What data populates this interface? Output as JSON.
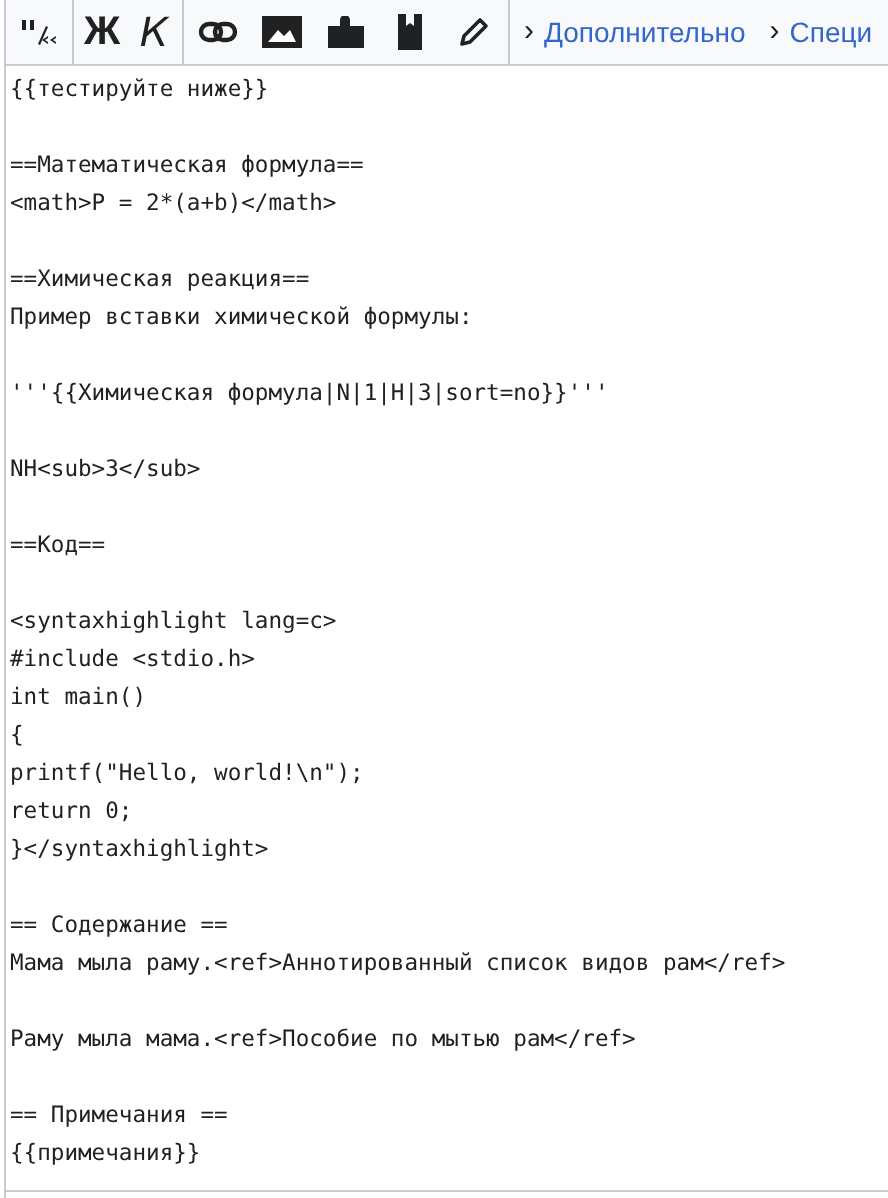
{
  "toolbar": {
    "buttons": [
      {
        "kind": "signature"
      },
      {
        "kind": "text",
        "label": "Ж",
        "italic": false
      },
      {
        "kind": "text",
        "label": "К",
        "italic": true
      },
      {
        "kind": "link"
      },
      {
        "kind": "image"
      },
      {
        "kind": "puzzle"
      },
      {
        "kind": "book"
      },
      {
        "kind": "pencil"
      }
    ],
    "menus": [
      {
        "arrow": "›",
        "label": "Дополнительно"
      },
      {
        "arrow": "›",
        "label": "Специ"
      }
    ]
  },
  "editor": {
    "blocks": [
      [
        "{{тестируйте ниже}}"
      ],
      [
        "==Математическая формула==",
        "<math>P = 2*(a+b)</math>"
      ],
      [
        "==Химическая реакция==",
        "Пример вставки химической формулы:"
      ],
      [
        "'''{{Химическая формула|N|1|H|3|sort=no}}'''"
      ],
      [
        "NH<sub>3</sub>"
      ],
      [
        "==Код=="
      ],
      [
        "<syntaxhighlight lang=c>",
        "#include <stdio.h>",
        "int main()",
        "{",
        "printf(\"Hello, world!\\n\");",
        "return 0;",
        "}</syntaxhighlight>"
      ],
      [
        "== Содержание ==",
        "Мама мыла раму.<ref>Аннотированный список видов рам</ref>"
      ],
      [
        "Раму мыла мама.<ref>Пособие по мытью рам</ref>"
      ],
      [
        "== Примечания ==",
        "{{примечания}}"
      ]
    ]
  }
}
